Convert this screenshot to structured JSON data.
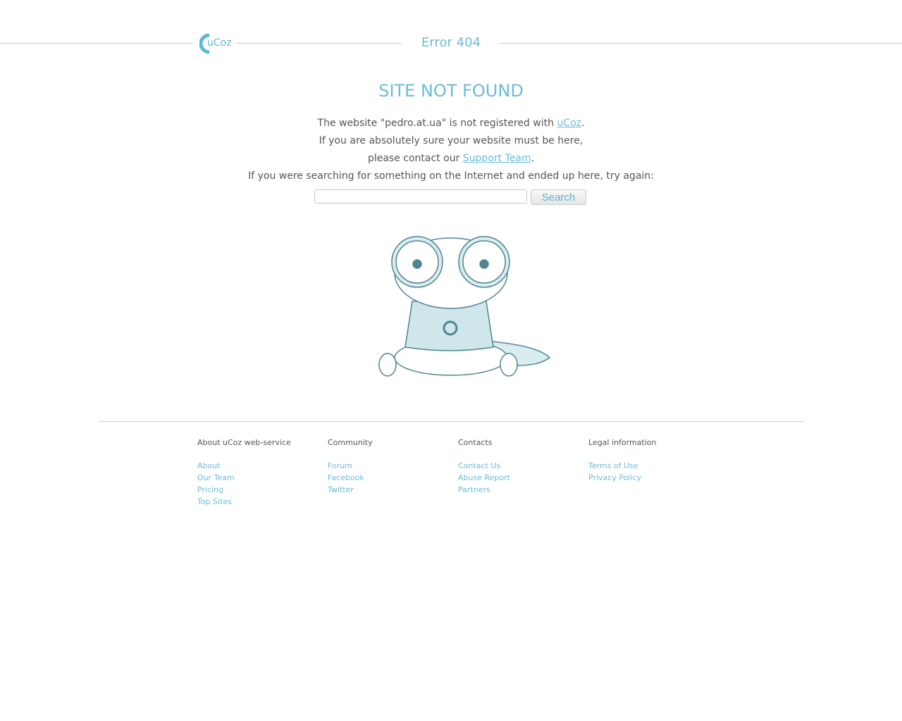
{
  "header": {
    "logo_text": "uCoz",
    "error": "Error 404"
  },
  "main": {
    "title": "SITE NOT FOUND",
    "line1_pre": "The website \"pedro.at.ua\" is not registered with ",
    "line1_link": "uCoz",
    "line1_post": ".",
    "line2": "If you are absolutely sure your website must be here,",
    "line3_pre": "please contact our ",
    "line3_link": "Support Team",
    "line3_post": ".",
    "line4": "If you were searching for something on the Internet and ended up here, try again:",
    "search_value": "",
    "search_button": "Search"
  },
  "footer": {
    "columns": [
      {
        "title": "About uCoz web-service",
        "links": [
          "About",
          "Our Team",
          "Pricing",
          "Top Sites"
        ]
      },
      {
        "title": "Community",
        "links": [
          "Forum",
          "Facebook",
          "Twitter"
        ]
      },
      {
        "title": "Contacts",
        "links": [
          "Contact Us",
          "Abuse Report",
          "Partners"
        ]
      },
      {
        "title": "Legal information",
        "links": [
          "Terms of Use",
          "Privacy Policy"
        ]
      }
    ]
  },
  "colors": {
    "accent": "#6bbcd9",
    "line": "#a9d6e5"
  }
}
